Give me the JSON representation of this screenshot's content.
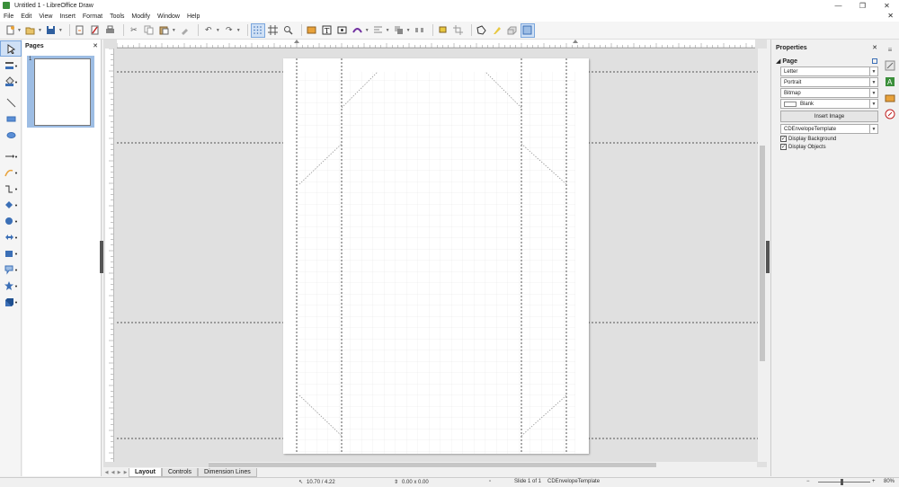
{
  "window": {
    "title": "Untitled 1 - LibreOffice Draw",
    "minimize": "—",
    "restore": "❐",
    "close": "✕"
  },
  "menu": {
    "items": [
      "File",
      "Edit",
      "View",
      "Insert",
      "Format",
      "Tools",
      "Modify",
      "Window",
      "Help"
    ],
    "close_doc": "✕"
  },
  "pages_panel": {
    "title": "Pages",
    "close": "✕",
    "thumbnails": [
      {
        "number": "1"
      }
    ]
  },
  "tabs": {
    "items": [
      "Layout",
      "Controls",
      "Dimension Lines"
    ],
    "active": "Layout"
  },
  "properties": {
    "title": "Properties",
    "close": "✕",
    "section": "Page",
    "format": "Letter",
    "orientation": "Portrait",
    "background": "Bitmap",
    "bitmap_name": "Blank",
    "insert_image": "Insert Image",
    "master_slide": "CDEnvelopeTemplate",
    "display_background": "Display Background",
    "display_objects": "Display Objects"
  },
  "status": {
    "position": "10.70 / 4.22",
    "size": "0.00 x 0.00",
    "slide": "Slide 1 of 1",
    "master": "CDEnvelopeTemplate",
    "zoom": "80%",
    "zoom_minus": "−",
    "zoom_plus": "+"
  },
  "colors": {
    "accent": "#3b6fb6",
    "active_bg": "#cfe0f5",
    "workspace": "#e0e0e0",
    "guide": "#555555"
  }
}
